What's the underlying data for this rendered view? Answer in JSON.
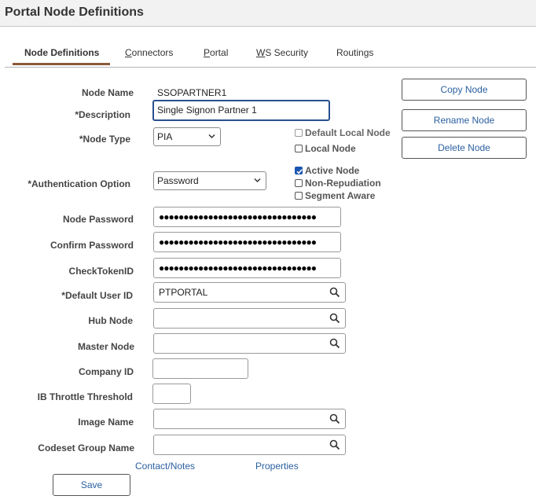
{
  "page": {
    "title": "Portal Node Definitions"
  },
  "tabs": [
    {
      "label": "Node Definitions",
      "active": true
    },
    {
      "label_u": "C",
      "label_rest": "onnectors"
    },
    {
      "label_pre": "",
      "label_u": "P",
      "label_rest": "ortal"
    },
    {
      "label_u": "W",
      "label_rest": "S Security"
    },
    {
      "label": "Routings"
    }
  ],
  "form": {
    "node_name": {
      "label": "Node Name",
      "value": "SSOPARTNER1"
    },
    "description": {
      "label": "*Description",
      "value": "Single Signon Partner 1"
    },
    "node_type": {
      "label": "*Node Type",
      "value": "PIA"
    },
    "auth_option": {
      "label": "*Authentication Option",
      "value": "Password"
    },
    "node_password": {
      "label": "Node Password",
      "value": "●●●●●●●●●●●●●●●●●●●●●●●●●●●●●●●●"
    },
    "confirm_password": {
      "label": "Confirm Password",
      "value": "●●●●●●●●●●●●●●●●●●●●●●●●●●●●●●●●"
    },
    "check_token_id": {
      "label": "CheckTokenID",
      "value": "●●●●●●●●●●●●●●●●●●●●●●●●●●●●●●●●"
    },
    "default_user_id": {
      "label": "*Default User ID",
      "value": "PTPORTAL"
    },
    "hub_node": {
      "label": "Hub Node",
      "value": ""
    },
    "master_node": {
      "label": "Master Node",
      "value": ""
    },
    "company_id": {
      "label": "Company ID",
      "value": ""
    },
    "ib_throttle": {
      "label": "IB Throttle Threshold",
      "value": ""
    },
    "image_name": {
      "label": "Image Name",
      "value": ""
    },
    "codeset_group": {
      "label": "Codeset Group Name",
      "value": ""
    }
  },
  "checkboxes": {
    "default_local_node": {
      "label": "Default Local Node",
      "checked": false
    },
    "local_node": {
      "label": "Local Node",
      "checked": false
    },
    "active_node": {
      "label": "Active Node",
      "checked": true
    },
    "non_repudiation": {
      "label": "Non-Repudiation",
      "checked": false
    },
    "segment_aware": {
      "label": "Segment Aware",
      "checked": false
    }
  },
  "buttons": {
    "copy_node": "Copy Node",
    "rename_node": "Rename Node",
    "delete_node": "Delete Node",
    "save": "Save"
  },
  "links": {
    "contact_notes": "Contact/Notes",
    "properties": "Properties"
  },
  "colors": {
    "accent": "#2a5fa0",
    "tab_indicator": "#8a5a3a",
    "check": "#1a56b0"
  }
}
